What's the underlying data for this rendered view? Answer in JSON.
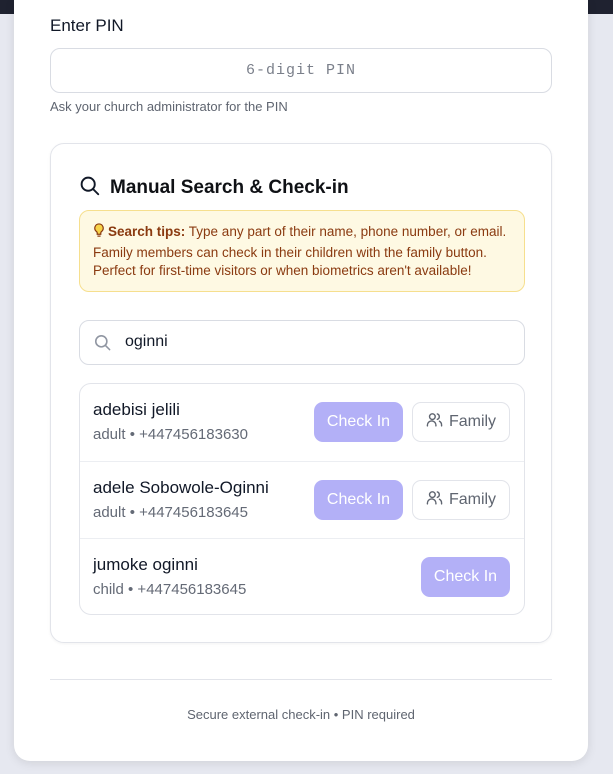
{
  "pin": {
    "label": "Enter PIN",
    "placeholder": "6-digit PIN",
    "help": "Ask your church administrator for the PIN"
  },
  "manual": {
    "title": "Manual Search & Check-in",
    "tips_label": "Search tips:",
    "tips_text": " Type any part of their name, phone number, or email. Family members can check in their children with the family button. Perfect for first-time visitors or when biometrics aren't available!",
    "search_value": "oginni"
  },
  "results": [
    {
      "name": "adebisi jelili",
      "meta": "adult • +447456183630",
      "checkin_label": "Check In",
      "family_label": "Family"
    },
    {
      "name": "adele Sobowole-Oginni",
      "meta": "adult • +447456183645",
      "checkin_label": "Check In",
      "family_label": "Family"
    },
    {
      "name": "jumoke oginni",
      "meta": "child • +447456183645",
      "checkin_label": "Check In"
    }
  ],
  "footer": "Secure external check-in • PIN required",
  "colors": {
    "accent_disabled": "#b3b0f7",
    "tips_bg": "#fef9e3",
    "tips_text": "#8a3a10"
  },
  "icons": [
    "search-icon",
    "lightbulb-icon",
    "users-icon"
  ]
}
